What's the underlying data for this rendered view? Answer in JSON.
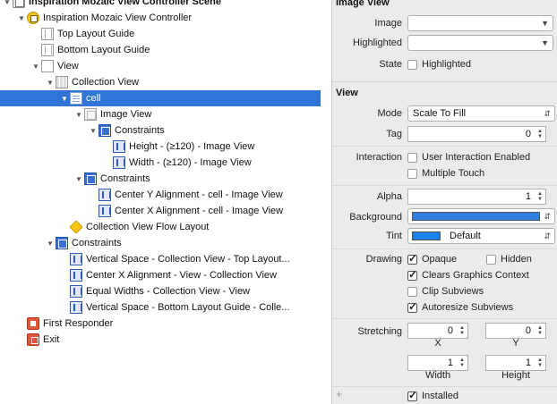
{
  "outline": {
    "items": [
      {
        "label": "Inspiration Mozaic View Controller Scene",
        "icon": "scene-icon",
        "name": "outline-scene"
      },
      {
        "label": "Inspiration Mozaic View Controller",
        "icon": "view-controller-icon",
        "name": "outline-view-controller"
      },
      {
        "label": "Top Layout Guide",
        "icon": "layout-guide-icon",
        "name": "outline-top-layout-guide"
      },
      {
        "label": "Bottom Layout Guide",
        "icon": "layout-guide-icon",
        "name": "outline-bottom-layout-guide"
      },
      {
        "label": "View",
        "icon": "view-icon",
        "name": "outline-view"
      },
      {
        "label": "Collection View",
        "icon": "collection-view-icon",
        "name": "outline-collection-view"
      },
      {
        "label": "cell",
        "icon": "collection-cell-icon",
        "name": "outline-cell"
      },
      {
        "label": "Image View",
        "icon": "image-view-icon",
        "name": "outline-image-view"
      },
      {
        "label": "Constraints",
        "icon": "constraints-group-icon",
        "name": "outline-image-view-constraints"
      },
      {
        "label": "Height - (≥120) - Image View",
        "icon": "constraint-icon",
        "name": "outline-constraint-height"
      },
      {
        "label": "Width - (≥120) - Image View",
        "icon": "constraint-icon",
        "name": "outline-constraint-width"
      },
      {
        "label": "Constraints",
        "icon": "constraints-group-icon",
        "name": "outline-cell-constraints"
      },
      {
        "label": "Center Y Alignment - cell - Image View",
        "icon": "constraint-icon",
        "name": "outline-constraint-center-y"
      },
      {
        "label": "Center X Alignment - cell - Image View",
        "icon": "constraint-icon",
        "name": "outline-constraint-center-x"
      },
      {
        "label": "Collection View Flow Layout",
        "icon": "flow-layout-icon",
        "name": "outline-flow-layout"
      },
      {
        "label": "Constraints",
        "icon": "constraints-group-icon",
        "name": "outline-view-constraints"
      },
      {
        "label": "Vertical Space - Collection View - Top Layout...",
        "icon": "constraint-icon",
        "name": "outline-constraint-vertical-top"
      },
      {
        "label": "Center X Alignment - View - Collection View",
        "icon": "constraint-icon",
        "name": "outline-constraint-center-x-view"
      },
      {
        "label": "Equal Widths - Collection View - View",
        "icon": "constraint-icon",
        "name": "outline-constraint-equal-widths"
      },
      {
        "label": "Vertical Space - Bottom Layout Guide - Colle...",
        "icon": "constraint-icon",
        "name": "outline-constraint-vertical-bottom"
      },
      {
        "label": "First Responder",
        "icon": "first-responder-icon",
        "name": "outline-first-responder"
      },
      {
        "label": "Exit",
        "icon": "exit-icon",
        "name": "outline-exit"
      }
    ],
    "selected_label": "cell"
  },
  "inspector": {
    "image_view": {
      "title": "Image View",
      "image_label": "Image",
      "image_value": "",
      "highlighted_label": "Highlighted",
      "highlighted_value": "",
      "state_label": "State",
      "state_highlighted_label": "Highlighted",
      "state_highlighted_checked": false
    },
    "view": {
      "title": "View",
      "mode_label": "Mode",
      "mode_value": "Scale To Fill",
      "tag_label": "Tag",
      "tag_value": "0",
      "interaction_label": "Interaction",
      "user_interaction_label": "User Interaction Enabled",
      "user_interaction_checked": false,
      "multiple_touch_label": "Multiple Touch",
      "multiple_touch_checked": false,
      "alpha_label": "Alpha",
      "alpha_value": "1",
      "background_label": "Background",
      "background_color": "#2f7fe0",
      "tint_label": "Tint",
      "tint_color": "#1a7fe6",
      "tint_value": "Default",
      "drawing_label": "Drawing",
      "opaque_label": "Opaque",
      "opaque_checked": true,
      "hidden_label": "Hidden",
      "hidden_checked": false,
      "clears_label": "Clears Graphics Context",
      "clears_checked": true,
      "clip_label": "Clip Subviews",
      "clip_checked": false,
      "autoresize_label": "Autoresize Subviews",
      "autoresize_checked": true,
      "stretching_label": "Stretching",
      "stretch_x_value": "0",
      "stretch_y_value": "0",
      "x_label": "X",
      "y_label": "Y",
      "stretch_width_value": "1",
      "stretch_height_value": "1",
      "width_label": "Width",
      "height_label": "Height",
      "installed_label": "Installed",
      "installed_checked": true,
      "add_symbol": "+"
    }
  }
}
